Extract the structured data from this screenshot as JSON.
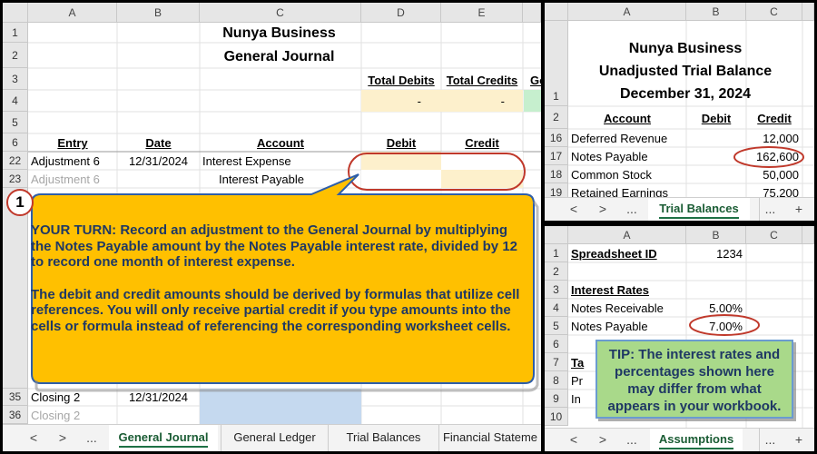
{
  "gj": {
    "cols": [
      "A",
      "B",
      "C",
      "D",
      "E"
    ],
    "rows": [
      "1",
      "2",
      "3",
      "4",
      "5",
      "6",
      "22",
      "23",
      "35",
      "36"
    ],
    "title1": "Nunya Business",
    "title2": "General Journal",
    "total_debits_label": "Total Debits",
    "total_credits_label": "Total Credits",
    "partial_header": "Go",
    "total_debits_value": "-",
    "total_credits_value": "-",
    "head_entry": "Entry",
    "head_date": "Date",
    "head_account": "Account",
    "head_debit": "Debit",
    "head_credit": "Credit",
    "r22_entry": "Adjustment 6",
    "r22_date": "12/31/2024",
    "r22_account": "Interest Expense",
    "r23_entry": "Adjustment 6",
    "r23_account": "Interest Payable",
    "r35_entry": "Closing 2",
    "r35_date": "12/31/2024",
    "r36_entry": "Closing 2",
    "tabs": [
      "General Journal",
      "General Ledger",
      "Trial Balances",
      "Financial Stateme"
    ],
    "nav": [
      "<",
      ">",
      "..."
    ]
  },
  "tb": {
    "cols": [
      "A",
      "B",
      "C"
    ],
    "rows": [
      "1",
      "2",
      "16",
      "17",
      "18",
      "19"
    ],
    "title1": "Nunya Business",
    "title2": "Unadjusted Trial Balance",
    "title3": "December 31, 2024",
    "head_account": "Account",
    "head_debit": "Debit",
    "head_credit": "Credit",
    "r16_account": "Deferred Revenue",
    "r16_credit": "12,000",
    "r17_account": "Notes Payable",
    "r17_credit": "162,600",
    "r18_account": "Common Stock",
    "r18_credit": "50,000",
    "r19_account": "Retained Earnings",
    "r19_credit": "75,200",
    "tab": "Trial Balances",
    "nav": [
      "<",
      ">",
      "...",
      "...",
      "+"
    ]
  },
  "as": {
    "cols": [
      "A",
      "B",
      "C"
    ],
    "rows": [
      "1",
      "2",
      "3",
      "4",
      "5",
      "6",
      "7",
      "8",
      "9",
      "10"
    ],
    "r1_a": "Spreadsheet ID",
    "r1_b": "1234",
    "r3_a": "Interest Rates",
    "r4_a": "Notes Receivable",
    "r4_b": "5.00%",
    "r5_a": "Notes Payable",
    "r5_b": "7.00%",
    "r7_a": "Ta",
    "r8_a": "Pr",
    "r9_a": "In",
    "tab": "Assumptions",
    "nav": [
      "<",
      ">",
      "...",
      "...",
      "+"
    ]
  },
  "callout": {
    "step": "1",
    "para1": "YOUR TURN: Record an adjustment to the General Journal by multiplying the Notes Payable amount by the Notes Payable interest rate, divided by 12 to record one month of interest expense.",
    "para2": "The debit and credit amounts should be derived by formulas that utilize cell references. You will only receive partial credit if you type amounts into the cells or formula instead of referencing the corresponding worksheet cells.",
    "fill": "#ffc000",
    "border": "#2e5ea8"
  },
  "tip": {
    "text": "TIP: The interest rates and percentages shown here may differ from what appears in your workbook.",
    "fill": "#a9d98a",
    "border": "#6a9bd0"
  },
  "colors": {
    "accent_green": "#1e7145",
    "highlight_red": "#c0392b",
    "input_fill": "#fdf0cc",
    "blue_fill": "#c5d9ef",
    "green_fill": "#c6efce"
  }
}
